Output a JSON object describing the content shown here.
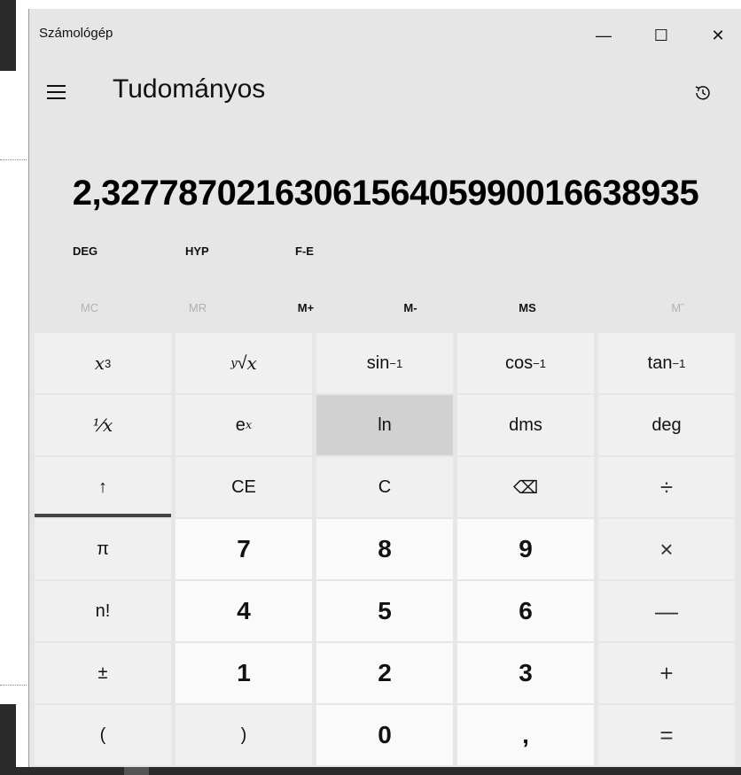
{
  "window": {
    "app_title": "Számológép",
    "controls": {
      "minimize": "—",
      "maximize": "☐",
      "close": "✕"
    }
  },
  "header": {
    "mode_title": "Tudományos",
    "menu_icon": "hamburger-menu-icon",
    "history_icon": "history-icon"
  },
  "display": {
    "value": "2,3277870216306156405990016638935"
  },
  "mode_buttons": [
    "DEG",
    "HYP",
    "F-E"
  ],
  "memory": {
    "mc": "MC",
    "mr": "MR",
    "mplus": "M+",
    "mminus": "M-",
    "ms": "MS",
    "mlist": "Mˇ"
  },
  "keys": {
    "r1": {
      "x3": "x",
      "x3_sup": "3",
      "yroot": "x",
      "yroot_sup": "y",
      "asin": "sin",
      "asin_sup": "−1",
      "acos": "cos",
      "acos_sup": "−1",
      "atan": "tan",
      "atan_sup": "−1"
    },
    "r2": {
      "recip": "⅟x",
      "ex": "e",
      "ex_sup": "x",
      "ln": "ln",
      "dms": "dms",
      "deg": "deg"
    },
    "r3": {
      "shift": "↑",
      "ce": "CE",
      "c": "C",
      "backspace": "⌫",
      "divide": "÷"
    },
    "r4": {
      "pi": "π",
      "seven": "7",
      "eight": "8",
      "nine": "9",
      "multiply": "×"
    },
    "r5": {
      "fact": "n!",
      "four": "4",
      "five": "5",
      "six": "6",
      "minus": "—"
    },
    "r6": {
      "plusminus": "±",
      "one": "1",
      "two": "2",
      "three": "3",
      "plus": "+"
    },
    "r7": {
      "lparen": "(",
      "rparen": ")",
      "zero": "0",
      "decimal": ",",
      "equals": "="
    }
  },
  "colors": {
    "window_bg": "#e6e6e6",
    "key_bg": "#f0f0f0",
    "num_key_bg": "#fafafa",
    "active_key_bg": "#d1d1d1"
  }
}
